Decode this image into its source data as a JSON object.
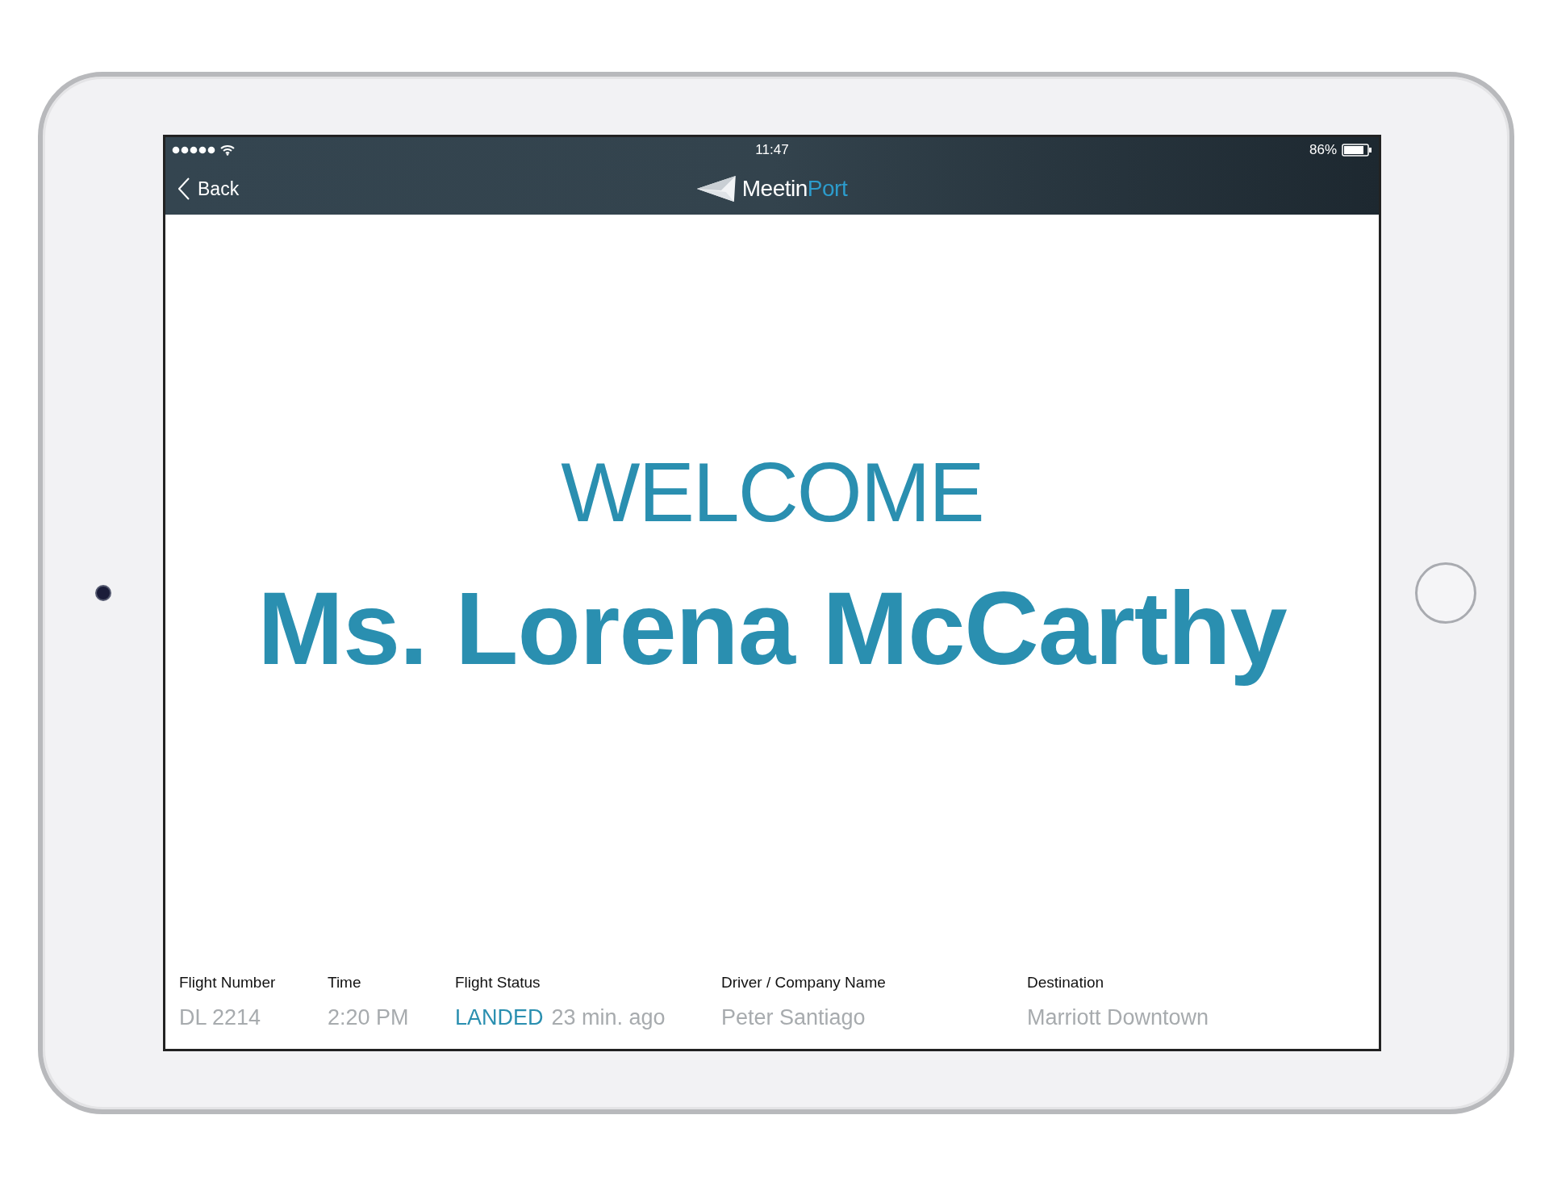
{
  "status_bar": {
    "time": "11:47",
    "battery": "86%"
  },
  "nav_bar": {
    "back": "Back",
    "logo": {
      "first": "Meetin",
      "second": "Port"
    }
  },
  "welcome": "WELCOME",
  "guest_name": "Ms. Lorena McCarthy",
  "details": [
    {
      "label": "Flight Number",
      "value": "DL 2214"
    },
    {
      "label": "Time",
      "value": "2:20 PM"
    },
    {
      "label": "Flight Status",
      "status": "LANDED",
      "value": "23 min. ago"
    },
    {
      "label": "Driver / Company Name",
      "value": "Peter Santiago"
    },
    {
      "label": "Destination",
      "value": "Marriott Downtown"
    }
  ]
}
